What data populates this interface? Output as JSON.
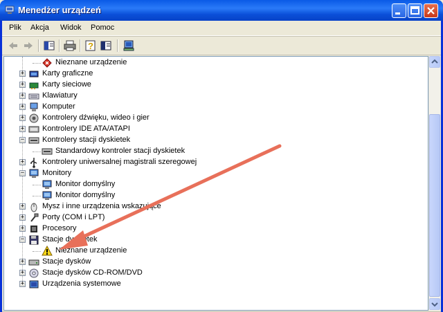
{
  "window": {
    "title": "Menedżer urządzeń"
  },
  "menu": [
    {
      "label": "Plik",
      "mnemonic": "P"
    },
    {
      "label": "Akcja",
      "mnemonic": "A"
    },
    {
      "label": "Widok",
      "mnemonic": "W"
    },
    {
      "label": "Pomoc",
      "mnemonic": "c"
    }
  ],
  "toolbar": {
    "buttons": [
      "back-icon",
      "forward-icon",
      "show-hide-tree-icon",
      "print-icon",
      "help-icon",
      "properties-icon",
      "update-driver-icon"
    ]
  },
  "tree": [
    {
      "label": "Nieznane urządzenie",
      "level": 1,
      "icon": "unknown-device-red-icon",
      "expander": ""
    },
    {
      "label": "Karty graficzne",
      "level": 0,
      "icon": "display-adapter-icon",
      "expander": "+"
    },
    {
      "label": "Karty sieciowe",
      "level": 0,
      "icon": "network-card-icon",
      "expander": "+"
    },
    {
      "label": "Klawiatury",
      "level": 0,
      "icon": "keyboard-icon",
      "expander": "+"
    },
    {
      "label": "Komputer",
      "level": 0,
      "icon": "computer-icon",
      "expander": "+"
    },
    {
      "label": "Kontrolery dźwięku, wideo i gier",
      "level": 0,
      "icon": "sound-controller-icon",
      "expander": "+"
    },
    {
      "label": "Kontrolery IDE ATA/ATAPI",
      "level": 0,
      "icon": "ide-controller-icon",
      "expander": "+"
    },
    {
      "label": "Kontrolery stacji dyskietek",
      "level": 0,
      "icon": "floppy-controller-icon",
      "expander": "−"
    },
    {
      "label": "Standardowy kontroler stacji dyskietek",
      "level": 1,
      "icon": "floppy-controller-icon",
      "expander": ""
    },
    {
      "label": "Kontrolery uniwersalnej magistrali szeregowej",
      "level": 0,
      "icon": "usb-icon",
      "expander": "+"
    },
    {
      "label": "Monitory",
      "level": 0,
      "icon": "monitor-icon",
      "expander": "−"
    },
    {
      "label": "Monitor domyślny",
      "level": 1,
      "icon": "monitor-icon",
      "expander": ""
    },
    {
      "label": "Monitor domyślny",
      "level": 1,
      "icon": "monitor-icon",
      "expander": ""
    },
    {
      "label": "Mysz i inne urządzenia wskazujące",
      "level": 0,
      "icon": "mouse-icon",
      "expander": "+"
    },
    {
      "label": "Porty (COM i LPT)",
      "level": 0,
      "icon": "port-icon",
      "expander": "+"
    },
    {
      "label": "Procesory",
      "level": 0,
      "icon": "processor-icon",
      "expander": "+"
    },
    {
      "label": "Stacje dyskietek",
      "level": 0,
      "icon": "floppy-drive-icon",
      "expander": "−"
    },
    {
      "label": "Nieznane urządzenie",
      "level": 1,
      "icon": "warning-icon",
      "expander": ""
    },
    {
      "label": "Stacje dysków",
      "level": 0,
      "icon": "disk-drive-icon",
      "expander": "+"
    },
    {
      "label": "Stacje dysków CD-ROM/DVD",
      "level": 0,
      "icon": "cdrom-icon",
      "expander": "+"
    },
    {
      "label": "Urządzenia systemowe",
      "level": 0,
      "icon": "system-device-icon",
      "expander": "+"
    }
  ],
  "colors": {
    "titlebar": "#0a5ae6",
    "arrow": "#e8705a",
    "tree_bg": "#ffffff"
  }
}
